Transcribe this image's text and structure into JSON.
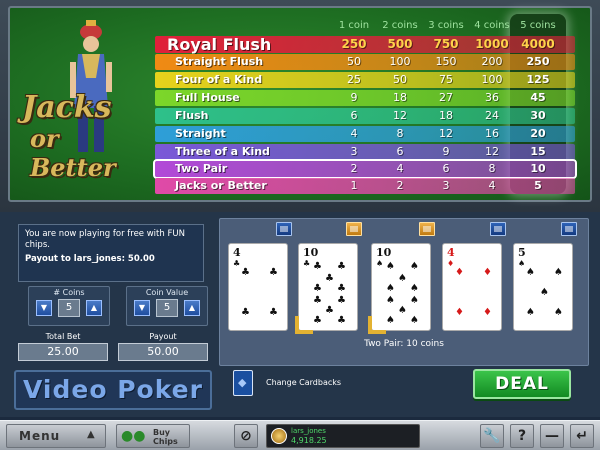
{
  "logo": {
    "line1": "Jacks",
    "line2": "or Better"
  },
  "paytable": {
    "headers": [
      "1 coin",
      "2 coins",
      "3 coins",
      "4 coins",
      "5 coins"
    ],
    "rows": [
      {
        "hand": "Royal Flush",
        "values": [
          "250",
          "500",
          "750",
          "1000",
          "4000"
        ],
        "color": "#e0203a"
      },
      {
        "hand": "Straight Flush",
        "values": [
          "50",
          "100",
          "150",
          "200",
          "250"
        ],
        "color": "#f08a14"
      },
      {
        "hand": "Four of a Kind",
        "values": [
          "25",
          "50",
          "75",
          "100",
          "125"
        ],
        "color": "#e6d21c"
      },
      {
        "hand": "Full House",
        "values": [
          "9",
          "18",
          "27",
          "36",
          "45"
        ],
        "color": "#7cd62a"
      },
      {
        "hand": "Flush",
        "values": [
          "6",
          "12",
          "18",
          "24",
          "30"
        ],
        "color": "#2ec08a"
      },
      {
        "hand": "Straight",
        "values": [
          "4",
          "8",
          "12",
          "16",
          "20"
        ],
        "color": "#2e9ed8"
      },
      {
        "hand": "Three of a Kind",
        "values": [
          "3",
          "6",
          "9",
          "12",
          "15"
        ],
        "color": "#7a58d8"
      },
      {
        "hand": "Two Pair",
        "values": [
          "2",
          "4",
          "6",
          "8",
          "10"
        ],
        "color": "#b24ad8"
      },
      {
        "hand": "Jacks or Better",
        "values": [
          "1",
          "2",
          "3",
          "4",
          "5"
        ],
        "color": "#e04aa8"
      }
    ],
    "winning_row": "Two Pair"
  },
  "message": {
    "line": "You are now playing for free with FUN chips.",
    "payout": "Payout to lars_jones: 50.00"
  },
  "controls": {
    "coins_label": "# Coins",
    "coins_value": "5",
    "coin_value_label": "Coin Value",
    "coin_value": "5",
    "total_bet_label": "Total Bet",
    "total_bet": "25.00",
    "payout_label": "Payout",
    "payout": "50.00",
    "down_glyph": "▼",
    "up_glyph": "▲"
  },
  "game_title": "Video Poker",
  "cards": [
    {
      "rank": "4",
      "suit": "♣",
      "color": "black",
      "held": false,
      "hold_lit": false
    },
    {
      "rank": "10",
      "suit": "♣",
      "color": "black",
      "held": true,
      "hold_lit": true
    },
    {
      "rank": "10",
      "suit": "♠",
      "color": "black",
      "held": true,
      "hold_lit": true
    },
    {
      "rank": "4",
      "suit": "♦",
      "color": "red",
      "held": false,
      "hold_lit": false
    },
    {
      "rank": "5",
      "suit": "♠",
      "color": "black",
      "held": false,
      "hold_lit": false
    }
  ],
  "result_text": "Two Pair: 10 coins",
  "change_cardbacks": "Change Cardbacks",
  "deal_label": "DEAL",
  "bottom": {
    "menu": "Menu",
    "menu_arrow": "▲",
    "buy_line1": "Buy",
    "buy_line2": "Chips",
    "user_name": "lars_jones",
    "balance": "4,918.25",
    "icons": [
      "wrench-icon",
      "help-icon",
      "minimize-icon",
      "return-icon"
    ]
  }
}
